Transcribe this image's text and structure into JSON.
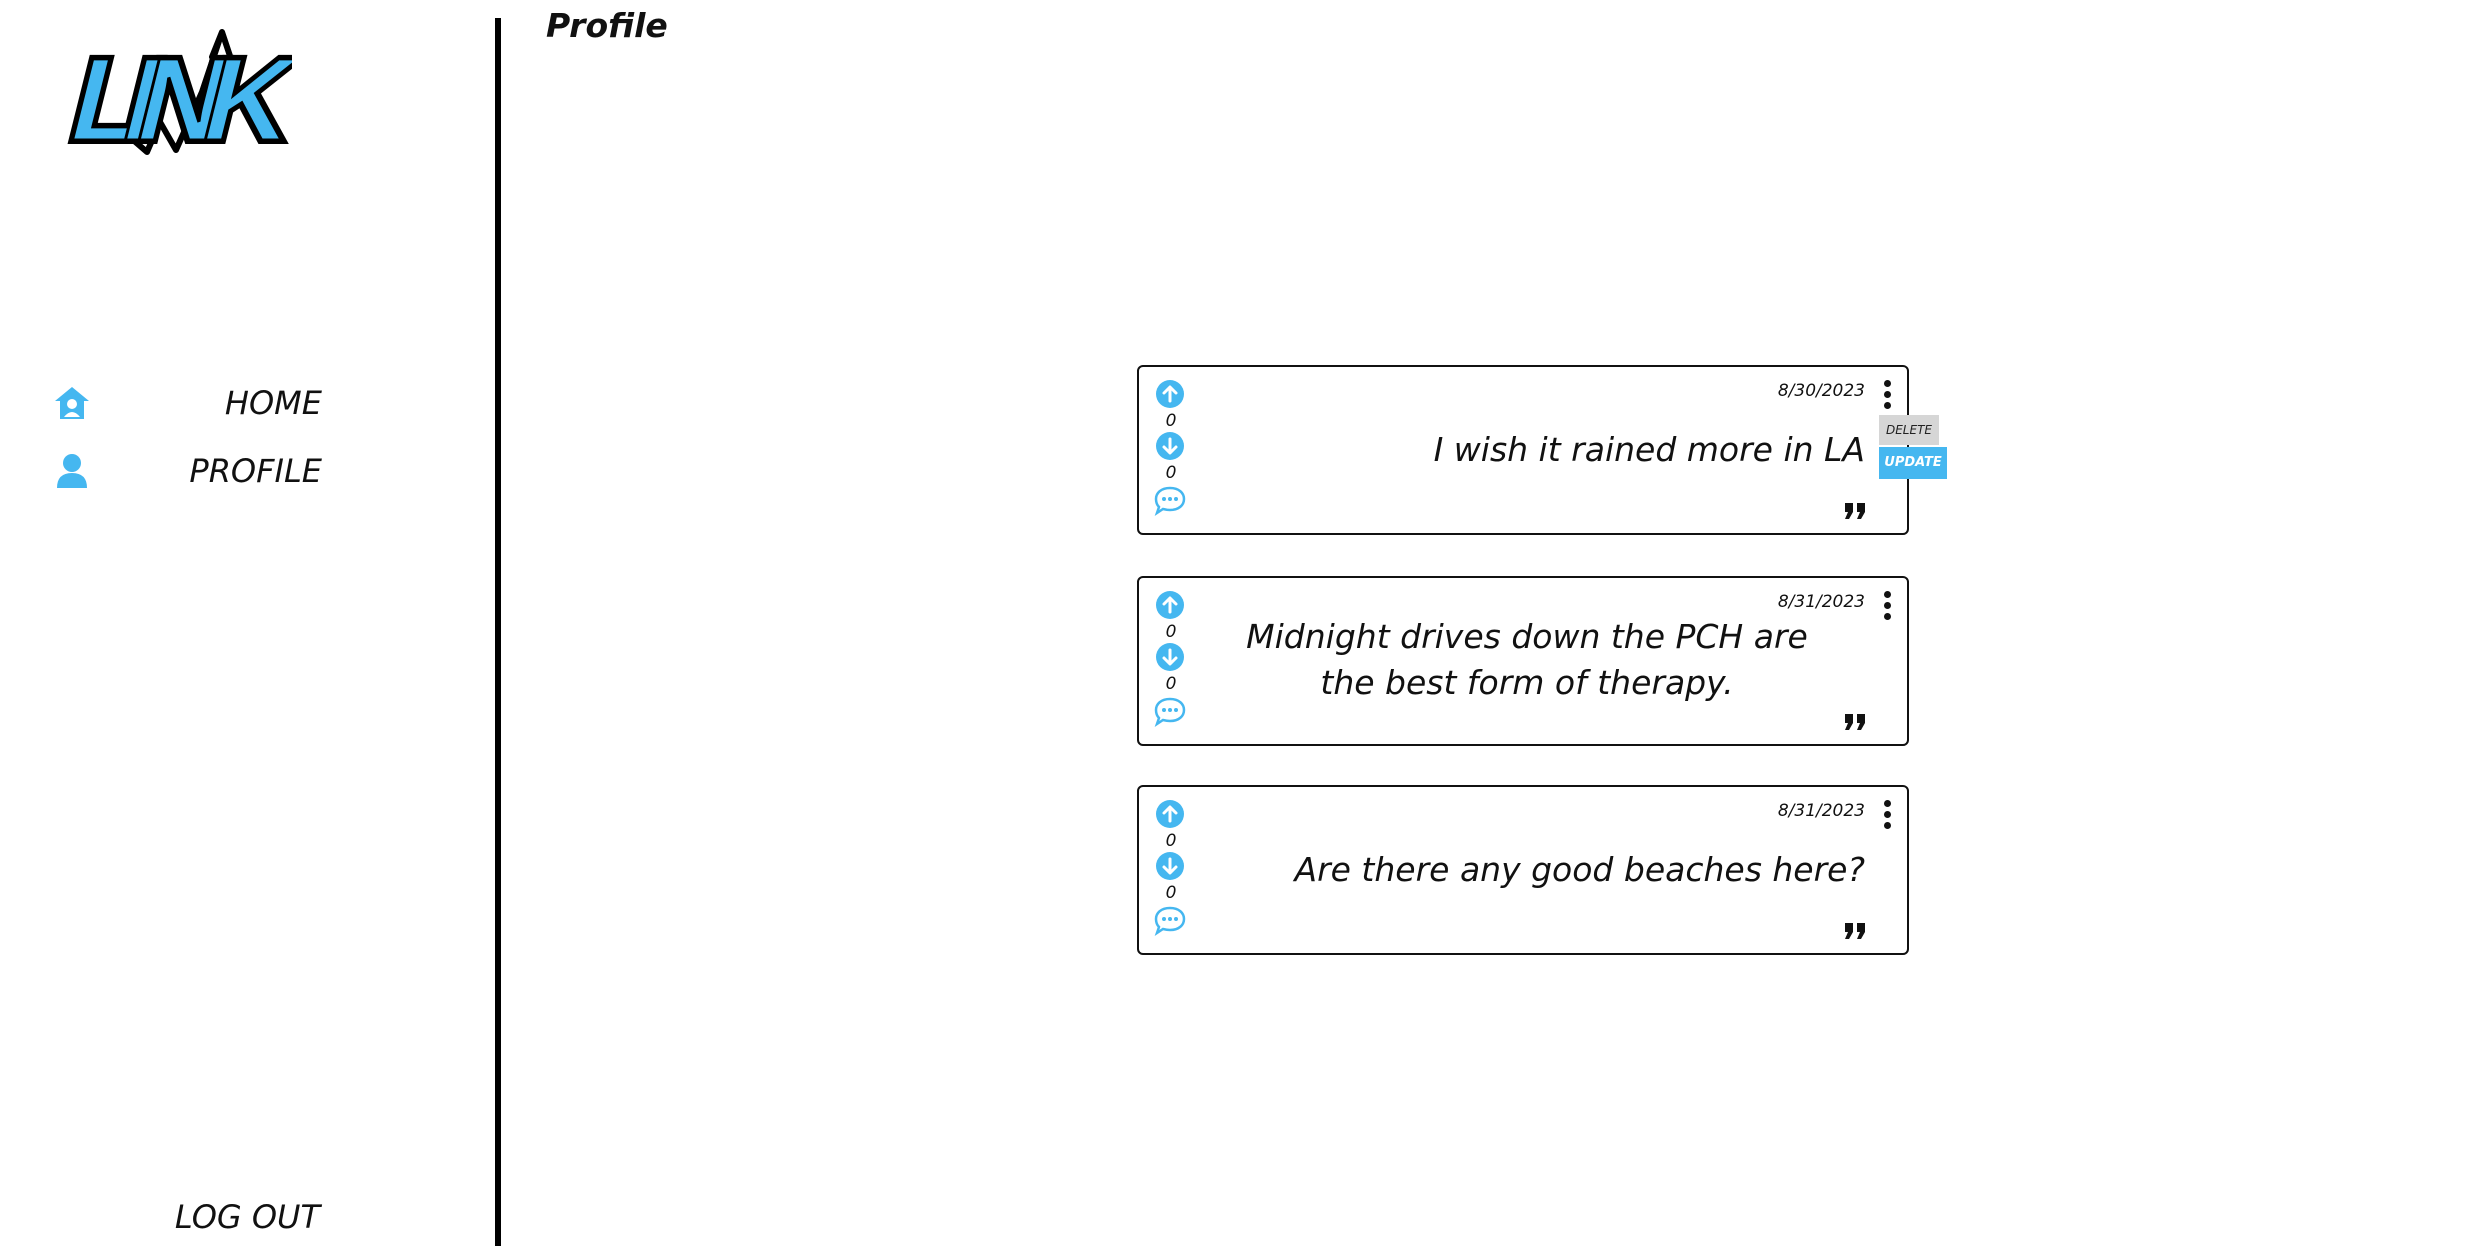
{
  "app": {
    "logo_text": "LINK",
    "accent_color": "#45b7f0"
  },
  "sidebar": {
    "items": [
      {
        "label": "HOME",
        "icon": "home-user-icon"
      },
      {
        "label": "PROFILE",
        "icon": "user-icon"
      }
    ],
    "logout_label": "LOG OUT"
  },
  "page": {
    "title": "Profile"
  },
  "posts": [
    {
      "date": "8/30/2023",
      "text": "I wish it rained more in LA",
      "upvotes": "0",
      "downvotes": "0"
    },
    {
      "date": "8/31/2023",
      "text": "Midnight drives down the PCH are the best form of therapy.",
      "upvotes": "0",
      "downvotes": "0"
    },
    {
      "date": "8/31/2023",
      "text": "Are there any good beaches here?",
      "upvotes": "0",
      "downvotes": "0"
    }
  ],
  "post_menu": {
    "delete_label": "DELETE",
    "update_label": "UPDATE"
  }
}
